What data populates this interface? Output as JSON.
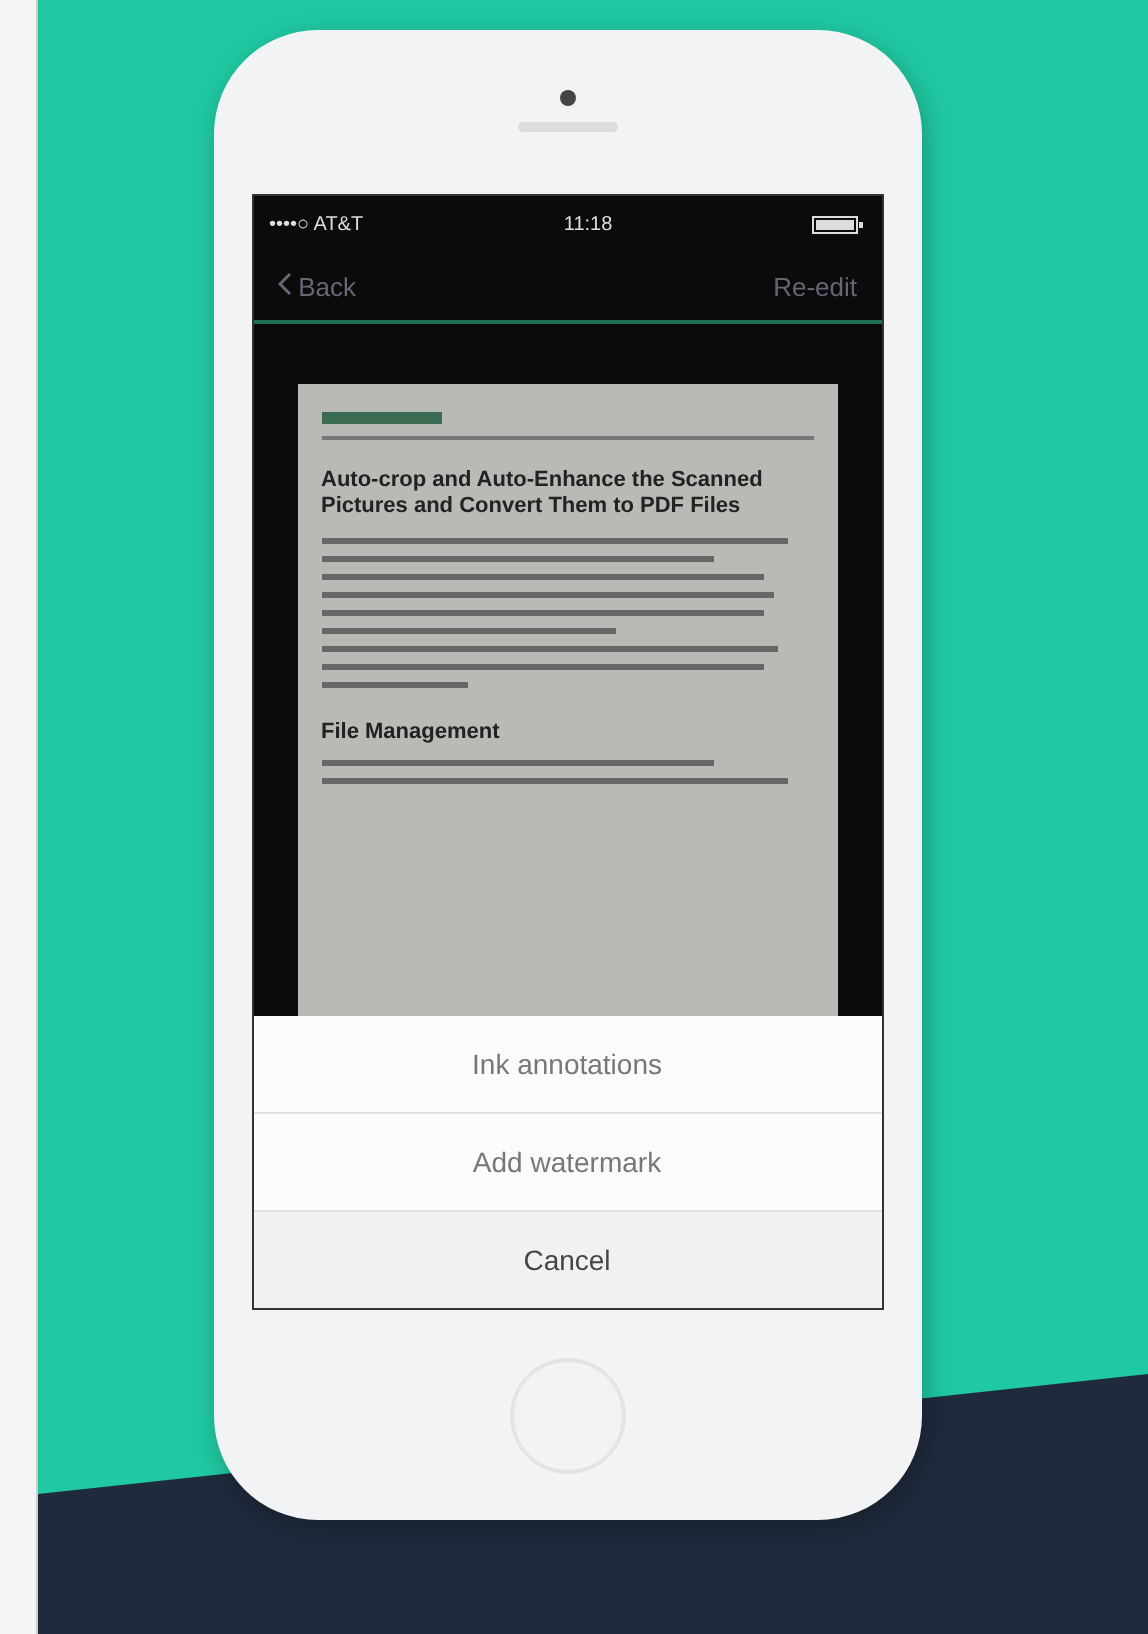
{
  "status_bar": {
    "carrier": "••••○ AT&T",
    "time": "11:18"
  },
  "nav_bar": {
    "back": "Back",
    "action": "Re-edit"
  },
  "document": {
    "heading": "Auto-crop and Auto-Enhance the Scanned Pictures and Convert Them to PDF Files",
    "section": "File Management"
  },
  "action_sheet": {
    "items": [
      {
        "label": "Ink annotations",
        "kind": "option"
      },
      {
        "label": "Add watermark",
        "kind": "option"
      },
      {
        "label": "Cancel",
        "kind": "cancel"
      }
    ]
  }
}
